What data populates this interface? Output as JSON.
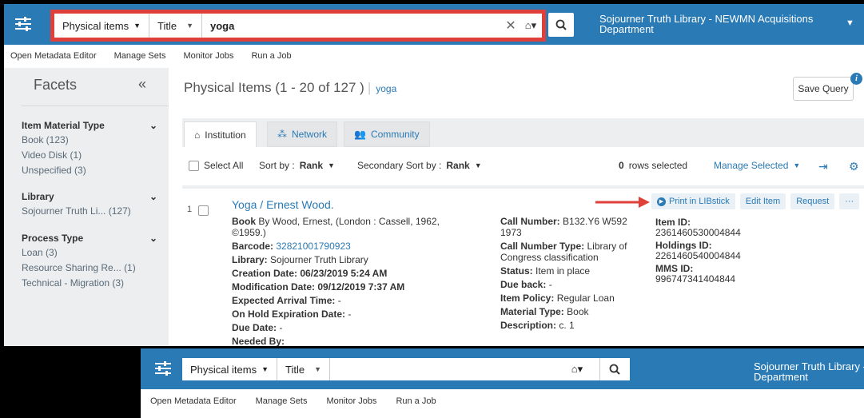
{
  "top": {
    "type_select": "Physical items",
    "field_select": "Title",
    "query": "yoga",
    "institution": "Sojourner Truth Library - NEWMN Acquisitions Department"
  },
  "subnav": [
    "Open Metadata Editor",
    "Manage Sets",
    "Monitor Jobs",
    "Run a Job"
  ],
  "facets": {
    "title": "Facets",
    "collapse": "«",
    "groups": [
      {
        "heading": "Item Material Type",
        "items": [
          "Book (123)",
          "Video Disk (1)",
          "Unspecified (3)"
        ]
      },
      {
        "heading": "Library",
        "items": [
          "Sojourner Truth Li... (127)"
        ]
      },
      {
        "heading": "Process Type",
        "items": [
          "Loan (3)",
          "Resource Sharing Re... (1)",
          "Technical - Migration (3)"
        ]
      }
    ]
  },
  "results": {
    "title": "Physical Items (1 - 20 of 127 )",
    "query": "yoga",
    "save_query": "Save Query",
    "info": "i"
  },
  "tabs": [
    "Institution",
    "Network",
    "Community"
  ],
  "panel": {
    "select_all": "Select All",
    "sort_label": "Sort by :",
    "sort_value": "Rank",
    "secondary_label": "Secondary Sort by :",
    "secondary_value": "Rank",
    "rows_count": "0",
    "rows_label": "rows selected",
    "manage_selected": "Manage Selected"
  },
  "record": {
    "num": "1",
    "title": "Yoga / Ernest Wood.",
    "col1": {
      "book_label": "Book",
      "book_value": "By Wood, Ernest, (London : Cassell, 1962, ©1959.)",
      "barcode_label": "Barcode:",
      "barcode_value": "32821001790923",
      "library_label": "Library:",
      "library_value": "Sojourner Truth Library",
      "creation_label": "Creation Date:",
      "creation_value": "06/23/2019 5:24 AM",
      "modification_label": "Modification Date:",
      "modification_value": "09/12/2019 7:37 AM",
      "arrival_label": "Expected Arrival Time:",
      "arrival_value": "-",
      "hold_label": "On Hold Expiration Date:",
      "hold_value": "-",
      "due_label": "Due Date:",
      "due_value": "-",
      "needed_label": "Needed By:"
    },
    "col2": {
      "callnum_label": "Call Number:",
      "callnum_value": "B132.Y6 W592 1973",
      "calltype_label": "Call Number Type:",
      "calltype_value": "Library of Congress classification",
      "status_label": "Status:",
      "status_value": "Item in place",
      "dueback_label": "Due back:",
      "dueback_value": "-",
      "policy_label": "Item Policy:",
      "policy_value": "Regular Loan",
      "material_label": "Material Type:",
      "material_value": "Book",
      "desc_label": "Description:",
      "desc_value": "c. 1"
    },
    "col3": {
      "item_id_label": "Item ID:",
      "item_id_value": "2361460530004844",
      "holdings_label": "Holdings ID:",
      "holdings_value": "2261460540004844",
      "mms_label": "MMS ID:",
      "mms_value": "996747341404844"
    },
    "actions": {
      "print": "Print in LIBstick",
      "edit": "Edit Item",
      "request": "Request",
      "more": "···"
    }
  },
  "bottom": {
    "type_select": "Physical items",
    "field_select": "Title",
    "institution_line1": "Sojourner Truth Library -",
    "institution_line2": "Department",
    "subnav": [
      "Open Metadata Editor",
      "Manage Sets",
      "Monitor Jobs",
      "Run a Job"
    ]
  },
  "colors": {
    "brand_blue": "#2a7ab5",
    "highlight_red": "#e0403a",
    "facet_bg": "#eceeef"
  }
}
